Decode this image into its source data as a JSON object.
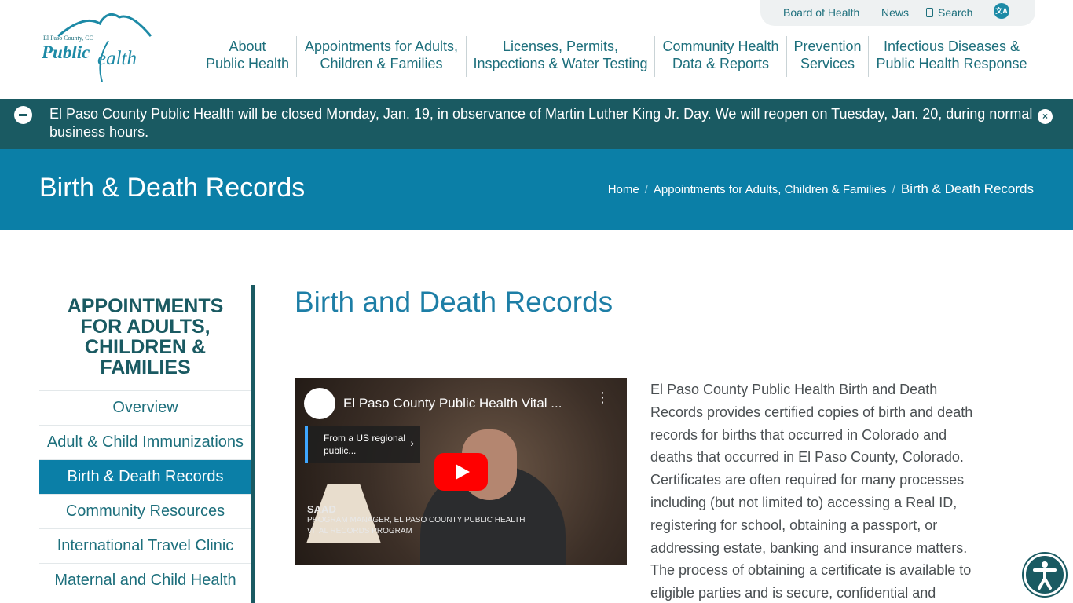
{
  "logo": {
    "county": "El Paso County, CO",
    "word1": "Public",
    "word2": "ealth"
  },
  "utility": {
    "board_of_health": "Board of Health",
    "news": "News",
    "search": "Search",
    "translate_icon": "translate-icon"
  },
  "nav": [
    {
      "line1": "About",
      "line2": "Public Health"
    },
    {
      "line1": "Appointments for Adults,",
      "line2": "Children & Families"
    },
    {
      "line1": "Licenses, Permits,",
      "line2": "Inspections & Water Testing"
    },
    {
      "line1": "Community Health",
      "line2": "Data & Reports"
    },
    {
      "line1": "Prevention",
      "line2": "Services"
    },
    {
      "line1": "Infectious Diseases &",
      "line2": "Public Health Response"
    }
  ],
  "alert": {
    "text": "El Paso County Public Health will be closed Monday, Jan. 19, in observance of Martin Luther King Jr. Day. We will reopen on Tuesday, Jan. 20, during normal business hours."
  },
  "band": {
    "title": "Birth & Death Records",
    "breadcrumbs": [
      "Home",
      "Appointments for Adults, Children & Families",
      "Birth & Death Records"
    ]
  },
  "sidebar": {
    "title": "APPOINTMENTS FOR ADULTS, CHILDREN & FAMILIES",
    "items": [
      {
        "label": "Overview",
        "active": false
      },
      {
        "label": "Adult & Child Immunizations",
        "active": false
      },
      {
        "label": "Birth & Death Records",
        "active": true
      },
      {
        "label": "Community Resources",
        "active": false
      },
      {
        "label": "International Travel Clinic",
        "active": false
      },
      {
        "label": "Maternal and Child Health",
        "active": false
      }
    ]
  },
  "main": {
    "title": "Birth and Death Records",
    "video": {
      "title": "El Paso County Public Health Vital ...",
      "card_text": "From a US regional public...",
      "lower_name": "SAAD",
      "lower_role": "PROGRAM MANAGER, EL PASO COUNTY PUBLIC HEALTH",
      "lower_program": "VITAL RECORDS PROGRAM"
    },
    "body": "El Paso County Public Health Birth and Death Records provides certified copies of birth and death records for births that occurred in Colorado and deaths that occurred in El Paso County, Colorado. Certificates are often required for many processes including (but not limited to) accessing a Real ID, registering for school, obtaining a passport, or addressing estate, banking and insurance matters. The process of obtaining a certificate is available to eligible parties and is secure, confidential and"
  },
  "accessibility_icon": "accessibility-icon",
  "colors": {
    "teal_dark": "#1a5a62",
    "blue_band": "#0b7fa7",
    "title_blue": "#1d7ea6"
  }
}
